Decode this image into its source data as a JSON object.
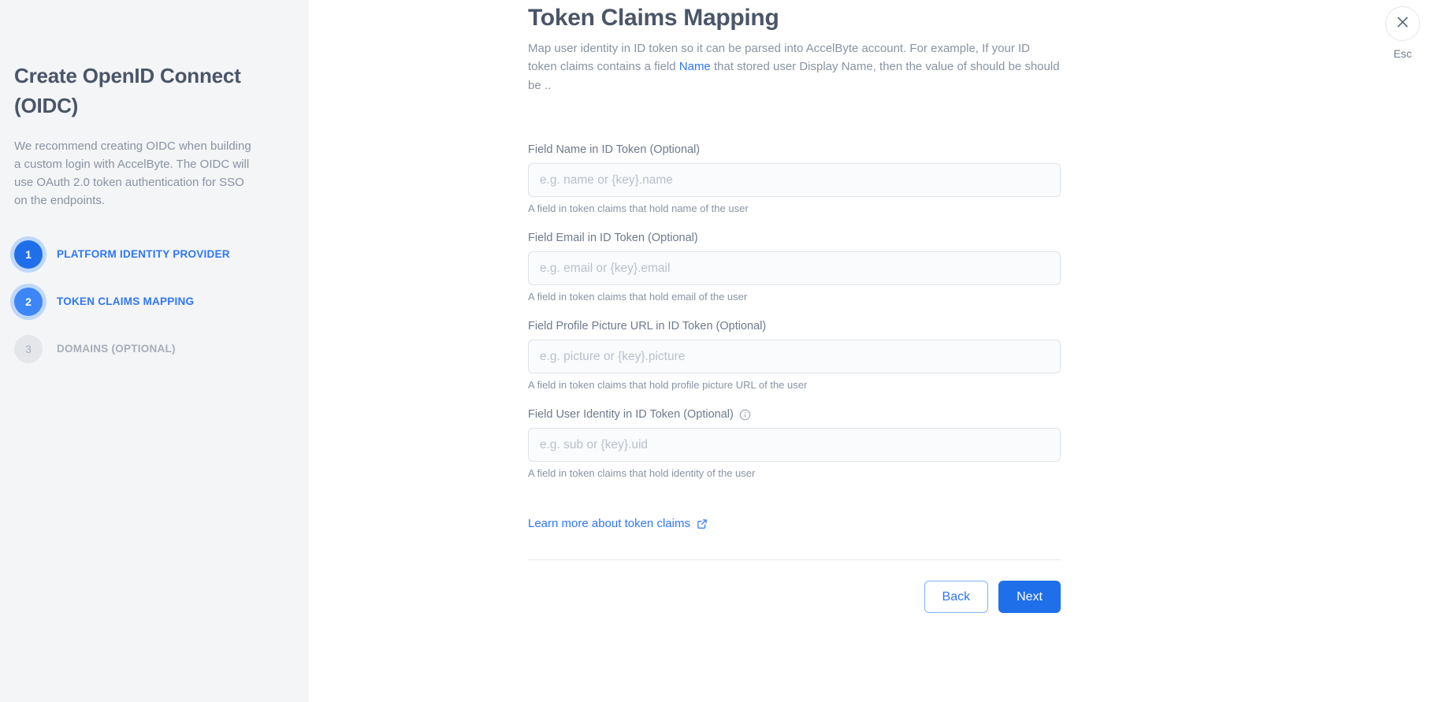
{
  "sidebar": {
    "title": "Create OpenID Connect (OIDC)",
    "description": "We recommend creating OIDC when building a custom login with AccelByte. The OIDC will use OAuth 2.0 token authentication for SSO on the endpoints.",
    "steps": [
      {
        "number": "1",
        "label": "PLATFORM IDENTITY PROVIDER",
        "state": "completed"
      },
      {
        "number": "2",
        "label": "TOKEN CLAIMS MAPPING",
        "state": "current"
      },
      {
        "number": "3",
        "label": "DOMAINS (OPTIONAL)",
        "state": "disabled"
      }
    ]
  },
  "main": {
    "title": "Token Claims Mapping",
    "description_part1": "Map user identity in ID token so it can be parsed into AccelByte account. For example, If your ID token claims contains a field ",
    "description_highlight": "Name",
    "description_part2": " that stored user Display Name, then the value of should be should be ..",
    "fields": [
      {
        "label": "Field Name in ID Token (Optional)",
        "placeholder": "e.g. name or {key}.name",
        "value": "",
        "help": "A field in token claims that hold name of the user",
        "has_info_icon": false
      },
      {
        "label": "Field Email in ID Token (Optional)",
        "placeholder": "e.g. email or {key}.email",
        "value": "",
        "help": "A field in token claims that hold email of the user",
        "has_info_icon": false
      },
      {
        "label": "Field Profile Picture URL in ID Token (Optional)",
        "placeholder": "e.g. picture or {key}.picture",
        "value": "",
        "help": "A field in token claims that hold profile picture URL of the user",
        "has_info_icon": false
      },
      {
        "label": "Field User Identity in ID Token (Optional)",
        "placeholder": "e.g. sub or {key}.uid",
        "value": "",
        "help": "A field in token claims that hold identity of the user",
        "has_info_icon": true
      }
    ],
    "learn_more_label": "Learn more about token claims",
    "buttons": {
      "back": "Back",
      "next": "Next"
    }
  },
  "close": {
    "icon": "close-icon",
    "esc_label": "Esc"
  },
  "icons": {
    "info": "info-circle-icon",
    "external_link": "external-link-icon"
  },
  "colors": {
    "accent": "#1f6feb",
    "link": "#2f77f5",
    "sidebar_bg": "#f4f5f7",
    "text_primary": "#4a5568",
    "text_muted": "#8a93a3",
    "input_bg": "#fafbfc",
    "border": "#dfe3ea"
  }
}
